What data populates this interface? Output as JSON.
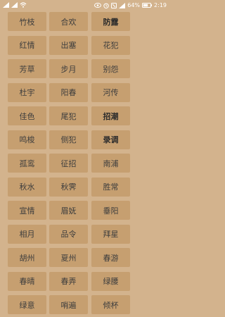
{
  "status_bar": {
    "left_icons": [
      "signal-icon",
      "signal-icon",
      "wifi-icon"
    ],
    "right_icons": [
      "eye-icon",
      "alarm-icon",
      "mute-icon",
      "signal-icon"
    ],
    "battery_percent": "64%",
    "time": "2:19"
  },
  "rows": [
    [
      {
        "label": "竹枝"
      },
      {
        "label": "合欢"
      },
      {
        "label": "防露",
        "bold": true
      }
    ],
    [
      {
        "label": "红情"
      },
      {
        "label": "出塞"
      },
      {
        "label": "花犯"
      }
    ],
    [
      {
        "label": "芳草"
      },
      {
        "label": "步月"
      },
      {
        "label": "别怨"
      }
    ],
    [
      {
        "label": "杜宇"
      },
      {
        "label": "阳春"
      },
      {
        "label": "河传"
      }
    ],
    [
      {
        "label": "佳色"
      },
      {
        "label": "尾犯"
      },
      {
        "label": "招潮",
        "bold": true
      }
    ],
    [
      {
        "label": "鸣梭"
      },
      {
        "label": "侧犯"
      },
      {
        "label": "录调",
        "bold": true
      }
    ],
    [
      {
        "label": "孤鸾"
      },
      {
        "label": "征招"
      },
      {
        "label": "南浦"
      }
    ],
    [
      {
        "label": "秋水"
      },
      {
        "label": "秋霁"
      },
      {
        "label": "胜常"
      }
    ],
    [
      {
        "label": "宣情"
      },
      {
        "label": "眉妩"
      },
      {
        "label": "垂阳"
      }
    ],
    [
      {
        "label": "相月"
      },
      {
        "label": "品令"
      },
      {
        "label": "拜星"
      }
    ],
    [
      {
        "label": "胡州"
      },
      {
        "label": "夏州"
      },
      {
        "label": "春游"
      }
    ],
    [
      {
        "label": "春晴"
      },
      {
        "label": "春弄"
      },
      {
        "label": "绿腰"
      }
    ],
    [
      {
        "label": "绿意"
      },
      {
        "label": "哨遍"
      },
      {
        "label": "倾杯"
      }
    ]
  ]
}
